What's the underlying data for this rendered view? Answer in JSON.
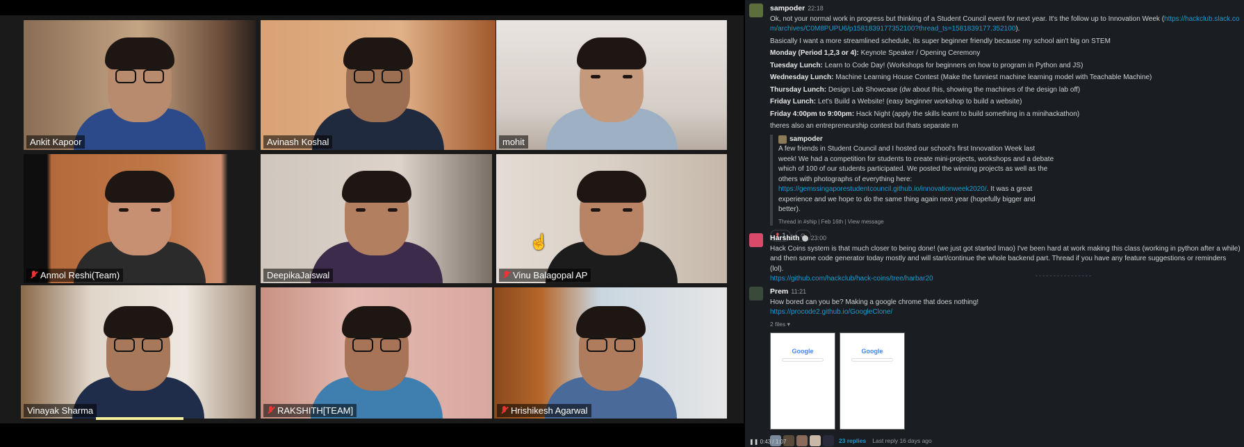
{
  "call": {
    "participants": [
      {
        "name": "Ankit Kapoor",
        "muted": false
      },
      {
        "name": "Avinash Koshal",
        "muted": false,
        "active_speaker": true
      },
      {
        "name": "mohit",
        "muted": false
      },
      {
        "name": "Anmol Reshi(Team)",
        "muted": true
      },
      {
        "name": "DeepikaJaiswal",
        "muted": false
      },
      {
        "name": "Vinu Balagopal AP",
        "muted": true
      },
      {
        "name": "Vinayak Sharma",
        "muted": false
      },
      {
        "name": "RAKSHITH[TEAM]",
        "muted": true
      },
      {
        "name": "Hrishikesh Agarwal",
        "muted": true
      }
    ]
  },
  "slack": {
    "msg1": {
      "author": "sampoder",
      "time": "22:18",
      "intro": "Ok, not your normal work in progress but thinking of a Student Council event for next year. It's the follow up to Innovation Week (",
      "intro_link": "https://hackclub.slack.com/archives/C0M8PUPU6/p1581839177352100?thread_ts=1581839177.352100",
      "intro_end": ").",
      "line2": "Basically I want a more streamlined schedule, its super beginner friendly because my school ain't big on STEM",
      "schedule": [
        {
          "day": "Monday (Period 1,2,3 or 4):",
          "text": " Keynote Speaker / Opening Ceremony"
        },
        {
          "day": "Tuesday Lunch:",
          "text": " Learn to Code Day! (Workshops for beginners on how to program in Python and JS)"
        },
        {
          "day": "Wednesday Lunch:",
          "text": " Machine Learning House Contest (Make the funniest machine learning model with Teachable Machine)"
        },
        {
          "day": "Thursday Lunch:",
          "text": " Design Lab Showcase (dw about this, showing the machines of the design lab off)"
        },
        {
          "day": "Friday Lunch:",
          "text": " Let's Build a Website! (easy beginner workshop to build a website)"
        },
        {
          "day": "Friday 4:00pm to 9:00pm:",
          "text": " Hack Night (apply the skills learnt to build something in a minihackathon)"
        }
      ],
      "line_last": "theres also an entrepreneurship contest but thats separate rn",
      "quote": {
        "author": "sampoder",
        "text1": "A few friends in Student Council and I hosted our school's first Innovation Week last week! We had a competition for students to create mini-projects, workshops and a debate which of 100 of our students participated. We posted the winning projects as well as the others with photographs of everything here: ",
        "link": "https://gemssingaporestudentcouncil.github.io/innovationweek2020/",
        "text2": ". It was a great experience and we hope to do the same thing again next year (hopefully bigger and better).",
        "meta": "Thread in #ship | Feb 16th | View message"
      },
      "reaction_count": "1"
    },
    "msg2": {
      "author": "Harshith",
      "time": "23:00",
      "text": "Hack Coins system is that much closer to being done! (we just got started lmao) I've been hard at work making this class (working in python after a while) and then some code generator today mostly and will start/continue the whole backend part. Thread if you have any feature suggestions or reminders (lol).",
      "link": "https://github.com/hackclub/hack-coins/tree/harbar20"
    },
    "msg3": {
      "author": "Prem",
      "time": "11:21",
      "text": "How bored can you be?  Making a google chrome that does nothing!",
      "link": "https://procode2.github.io/GoogleClone/",
      "files": "2 files ▾",
      "thumb_logo": "Google",
      "replies": "23 replies",
      "last_reply": "Last reply 16 days ago"
    },
    "player_time": "0:43 / 1:07"
  },
  "colors": {
    "link": "#1d9bd1",
    "active_speaker": "#d8e58a",
    "slack_bg": "#1a1d21"
  }
}
